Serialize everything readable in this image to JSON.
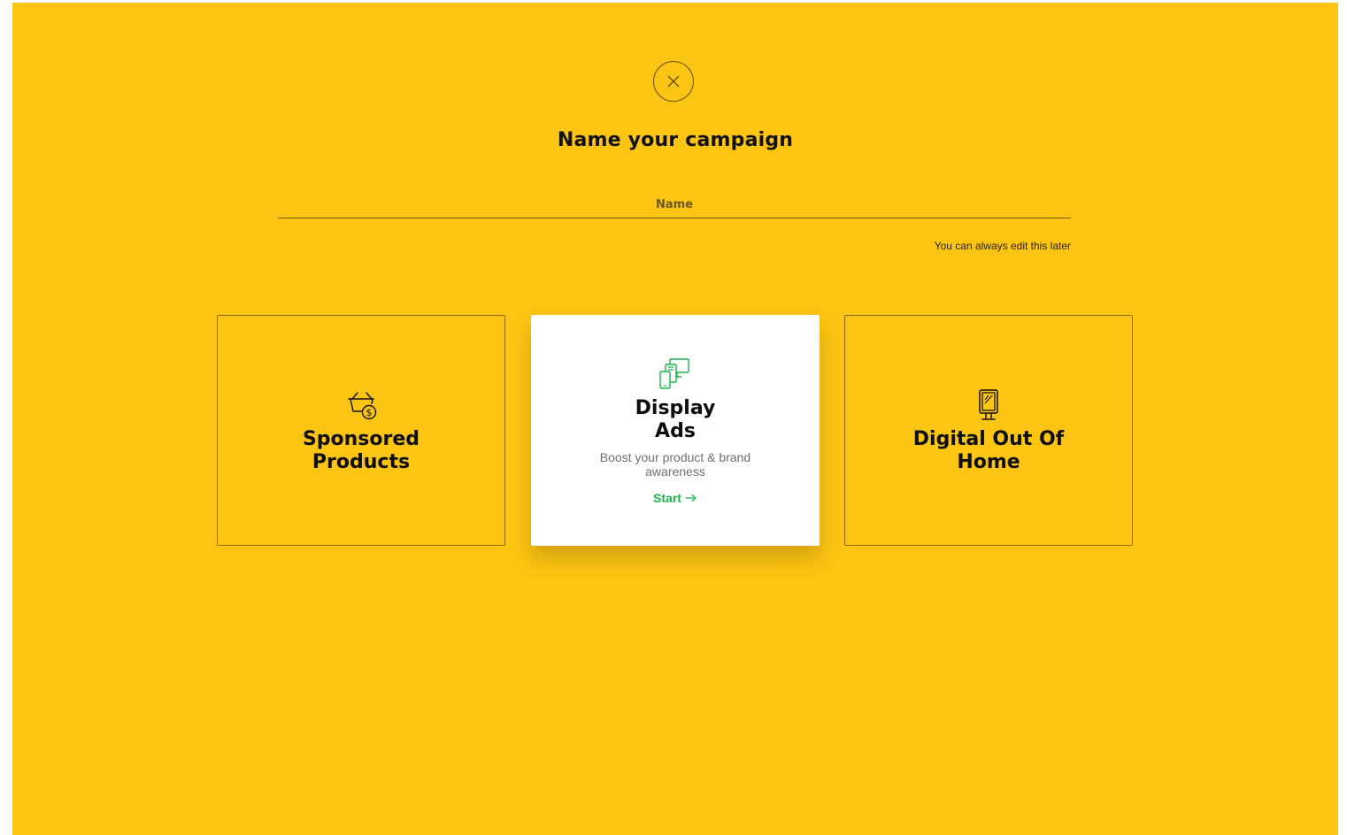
{
  "page": {
    "title": "Name your campaign",
    "background_color": "#fcc513",
    "close_icon": "close-icon"
  },
  "name_input": {
    "placeholder": "Name",
    "value": "",
    "hint": "You can always edit this later"
  },
  "cards": [
    {
      "title": "Sponsored\nProducts",
      "icon": "basket-dollar-icon",
      "selected": false
    },
    {
      "title": "Display\nAds",
      "icon": "devices-icon",
      "description": "Boost your product & brand awareness",
      "cta": "Start",
      "cta_icon": "arrow-right-icon",
      "selected": true,
      "accent_color": "#1bb54b"
    },
    {
      "title": "Digital Out Of\nHome",
      "icon": "billboard-icon",
      "selected": false
    }
  ]
}
